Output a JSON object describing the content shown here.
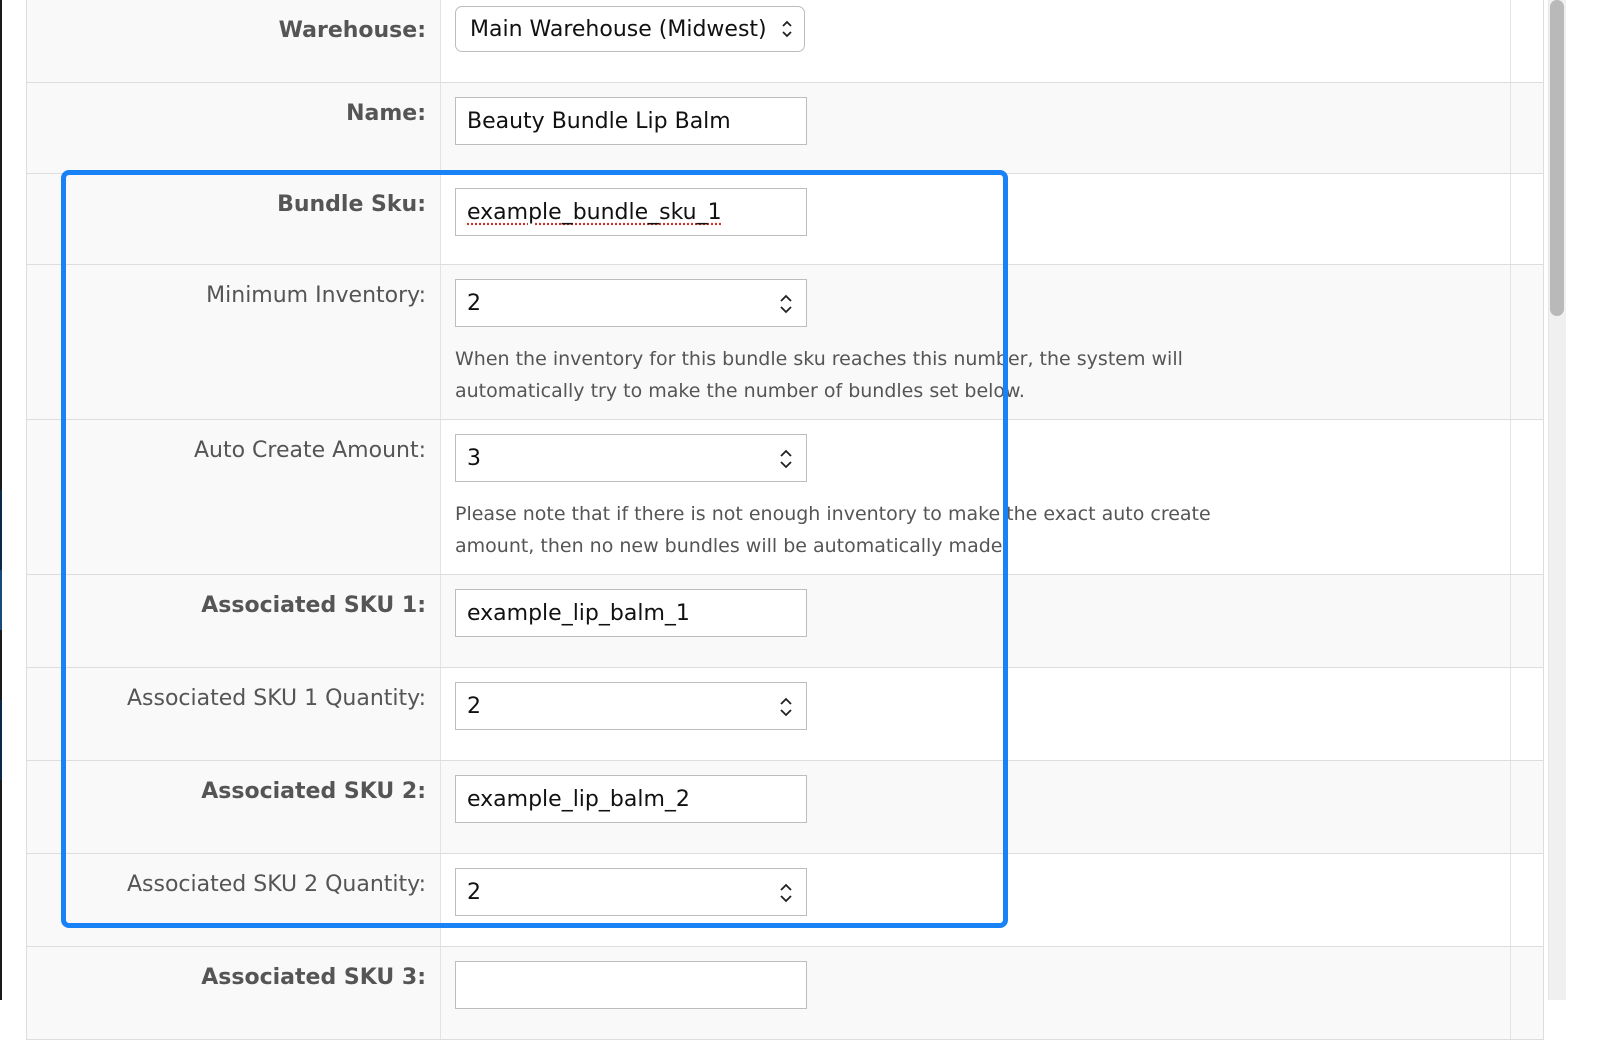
{
  "form": {
    "warehouse": {
      "label": "Warehouse:",
      "selected": "Main Warehouse (Midwest)"
    },
    "name": {
      "label": "Name:",
      "value": "Beauty Bundle Lip Balm"
    },
    "bundle_sku": {
      "label": "Bundle Sku:",
      "value": "example_bundle_sku_1"
    },
    "minimum_inventory": {
      "label": "Minimum Inventory:",
      "value": "2",
      "help": "When the inventory for this bundle sku reaches this number, the system will automatically try to make the number of bundles set below."
    },
    "auto_create_amount": {
      "label": "Auto Create Amount:",
      "value": "3",
      "help": "Please note that if there is not enough inventory to make the exact auto create amount, then no new bundles will be automatically made"
    },
    "associated_sku_1": {
      "label": "Associated SKU 1:",
      "value": "example_lip_balm_1"
    },
    "associated_sku_1_qty": {
      "label": "Associated SKU 1 Quantity:",
      "value": "2"
    },
    "associated_sku_2": {
      "label": "Associated SKU 2:",
      "value": "example_lip_balm_2"
    },
    "associated_sku_2_qty": {
      "label": "Associated SKU 2 Quantity:",
      "value": "2"
    },
    "associated_sku_3": {
      "label": "Associated SKU 3:",
      "value": ""
    }
  },
  "icons": {
    "select_chevron": "chevron-up-down-icon",
    "number_stepper": "stepper-arrows-icon"
  },
  "colors": {
    "highlight": "#1a82f7",
    "label_bg": "#f9f9f9",
    "border": "#dddddd"
  }
}
